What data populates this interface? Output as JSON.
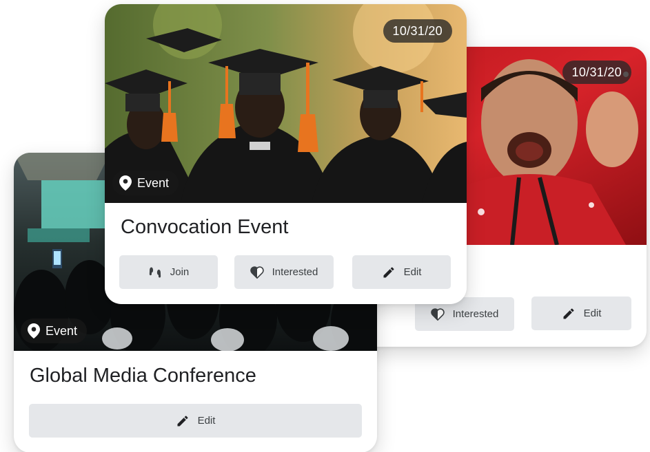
{
  "cards": {
    "sports": {
      "date": "10/31/20",
      "buttons": {
        "interested": "Interested",
        "edit": "Edit"
      }
    },
    "conference": {
      "tag": "Event",
      "title": "Global Media Conference",
      "buttons": {
        "edit": "Edit"
      }
    },
    "convocation": {
      "date": "10/31/20",
      "tag": "Event",
      "title": "Convocation Event",
      "buttons": {
        "join": "Join",
        "interested": "Interested",
        "edit": "Edit"
      }
    }
  },
  "icons": {
    "tag": "location-pin-icon",
    "join": "footsteps-icon",
    "interested": "heart-icon",
    "edit": "pencil-icon"
  },
  "colors": {
    "button_bg": "#e5e7ea",
    "badge_bg": "#282828",
    "text": "#202124"
  }
}
